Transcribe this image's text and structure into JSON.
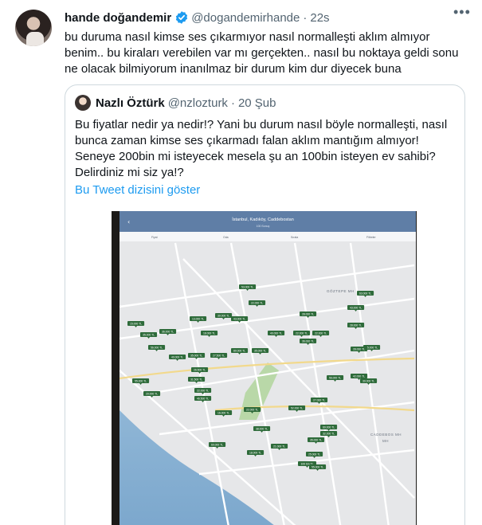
{
  "tweet": {
    "author_name": "hande doğandemir",
    "handle": "@dogandemirhande",
    "separator": "·",
    "time": "22s",
    "more_icon": "more-horizontal-icon",
    "verified_icon": "verified-badge-icon",
    "text": "bu duruma nasıl kimse ses çıkarmıyor nasıl normalleşti aklım almıyor benim.. bu kiraları verebilen var mı gerçekten.. nasıl bu noktaya geldi sonu ne olacak bilmiyorum inanılmaz bir durum kim dur diyecek buna"
  },
  "quote": {
    "author_name": "Nazlı Öztürk",
    "handle": "@nzlozturk",
    "separator": "·",
    "time": "20 Şub",
    "text": "Bu fiyatlar nedir ya nedir!? Yani bu durum nasıl böyle normalleşti, nasıl bunca zaman kimse ses çıkarmadı falan aklım mantığım almıyor! Seneye 200bin mi isteyecek mesela şu an 100bin isteyen ev sahibi? Delirdiniz mi siz ya!?",
    "show_thread": "Bu Tweet dizisini göster"
  },
  "map": {
    "title": "İstanbul, Kadıköy, Caddebostan",
    "subtitle": "100 Sonuç",
    "filters": [
      "Fiyat",
      "Oda",
      "Sırala",
      "Filtreler"
    ],
    "area_labels": [
      "GÖZTEPE MH",
      "CADDEBOS MH",
      "MH"
    ],
    "price_tags": [
      "53.000 TL",
      "22.000 TL",
      "13.000 TL",
      "18.000 TL",
      "30.000 TL",
      "43.000 TL",
      "40.000 TL",
      "63.000 TL",
      "43.000 TL",
      "28.000 TL",
      "22.000 TL",
      "15.000 TL",
      "35.000 TL",
      "36.000 TL",
      "56.000 TL",
      "40.000 TL",
      "35.000 TL",
      "27.500 TL",
      "26.500 TL",
      "80.000 TL",
      "35.000 TL",
      "22.000 TL",
      "36.000 TL",
      "28.000 TL",
      "55.000 TL",
      "31.500 TL",
      "55.000 TL",
      "22.000 TL",
      "20.000 TL",
      "46.500 TL",
      "56.000 TL",
      "42.000 TL",
      "30.000 TL",
      "27.000 TL",
      "16.000 TL",
      "22.000 TL",
      "60.000 TL",
      "35.000 TL",
      "18.000 TL",
      "60.000 TL",
      "32.000 TL",
      "25.000 TL",
      "21.000 TL",
      "100 bin TL",
      "55.000 TL",
      "38.000 TL",
      "52.000 TL",
      "28.000 TL"
    ]
  }
}
